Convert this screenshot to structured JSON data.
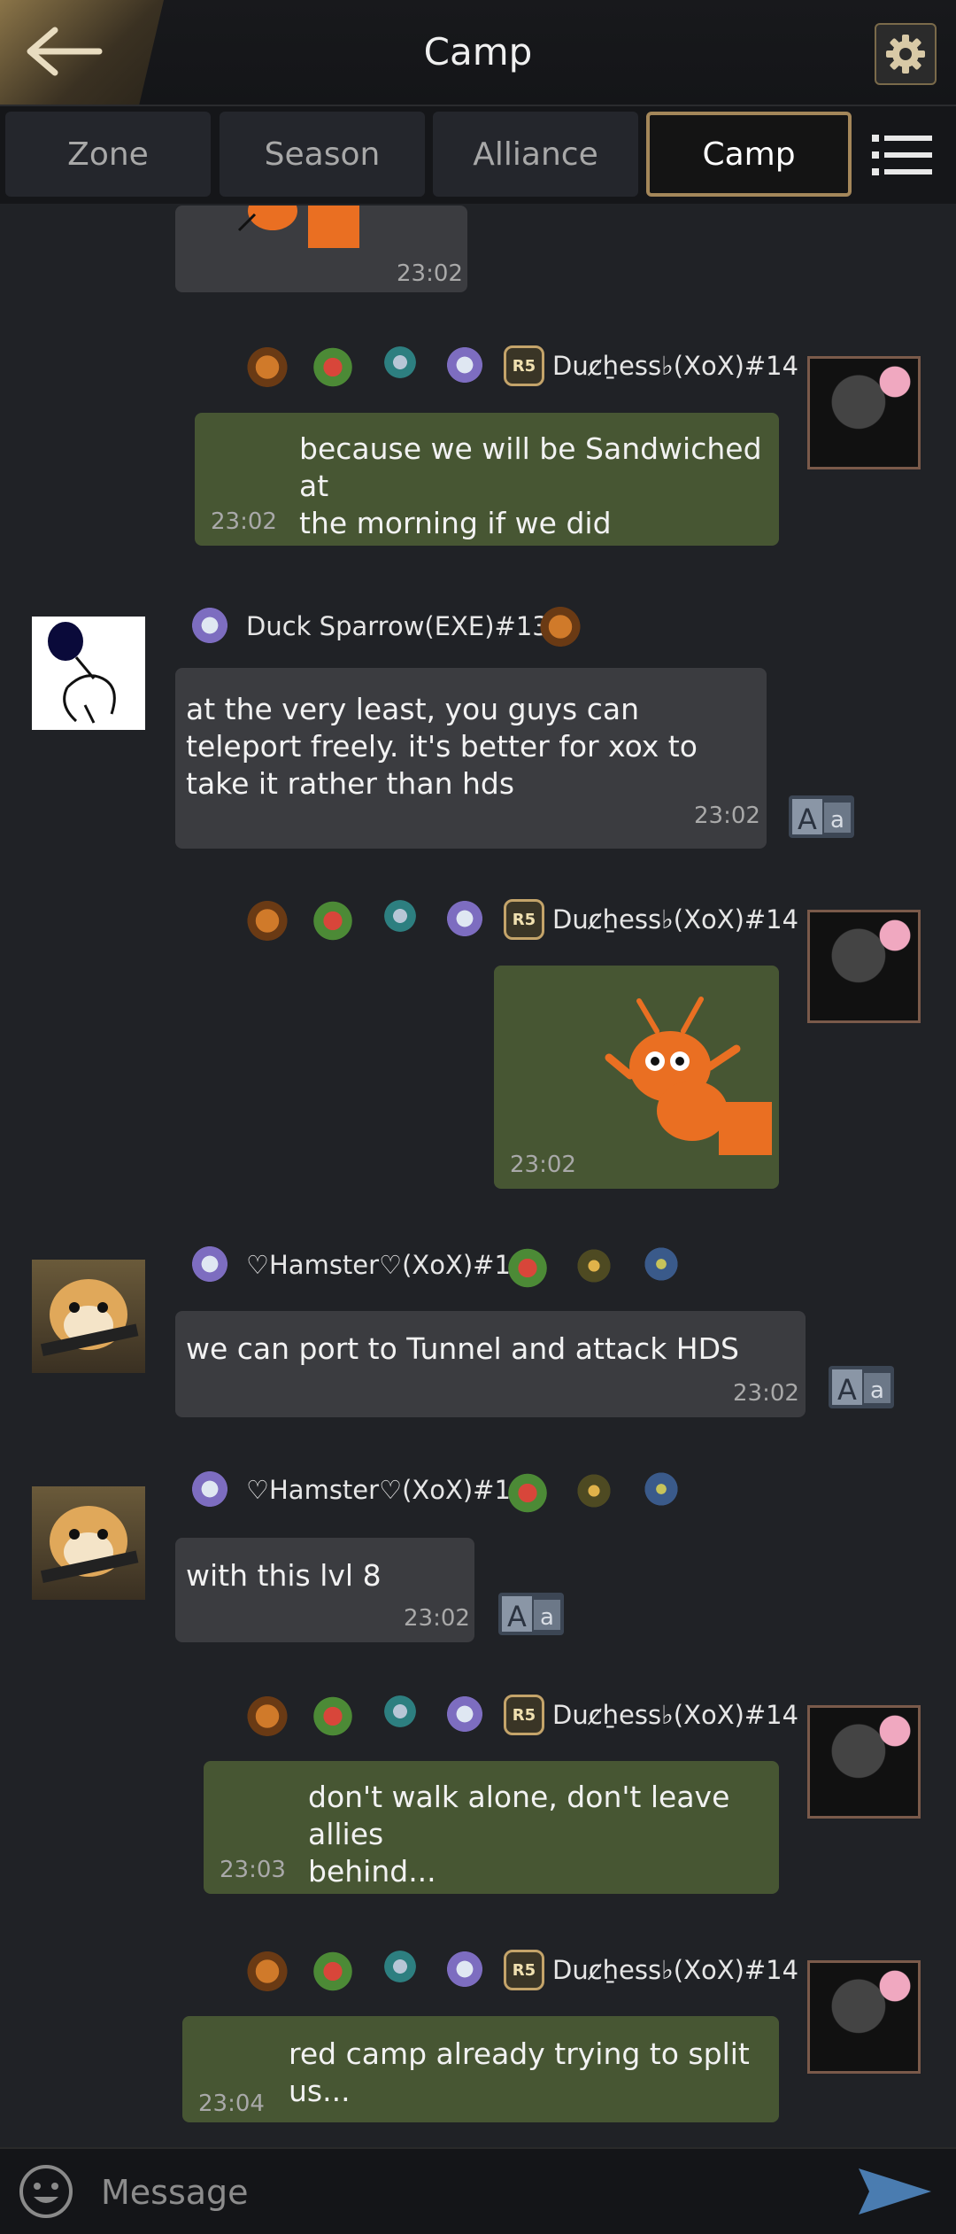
{
  "header": {
    "title": "Camp"
  },
  "tabs": [
    {
      "label": "Zone",
      "active": false
    },
    {
      "label": "Season",
      "active": false
    },
    {
      "label": "Alliance",
      "active": false
    },
    {
      "label": "Camp",
      "active": true
    }
  ],
  "rank_label": "R5",
  "messages": [
    {
      "sender": "",
      "text": "",
      "time": "23:02",
      "type": "sticker",
      "direction": "incoming"
    },
    {
      "sender": "Duc̷ẖess♭(XoX)#14",
      "text": "because we will be Sandwiched at\nthe morning if we did",
      "time": "23:02",
      "direction": "outgoing"
    },
    {
      "sender": "Duck Sparrow(EXE)#133",
      "text": "at the very least, you guys can\nteleport freely. it's better for xox to\ntake it rather than hds",
      "time": "23:02",
      "direction": "incoming"
    },
    {
      "sender": "Duc̷ẖess♭(XoX)#14",
      "text": "",
      "time": "23:02",
      "type": "sticker",
      "direction": "outgoing"
    },
    {
      "sender": "♡Hamster♡(XoX)#14",
      "text": "we can port to Tunnel and attack HDS",
      "time": "23:02",
      "direction": "incoming"
    },
    {
      "sender": "♡Hamster♡(XoX)#14",
      "text": "with this lvl 8",
      "time": "23:02",
      "direction": "incoming"
    },
    {
      "sender": "Duc̷ẖess♭(XoX)#14",
      "text": "don't walk alone, don't leave allies\nbehind...",
      "time": "23:03",
      "direction": "outgoing"
    },
    {
      "sender": "Duc̷ẖess♭(XoX)#14",
      "text": "red camp already trying to split us...",
      "time": "23:04",
      "direction": "outgoing"
    }
  ],
  "composer": {
    "placeholder": "Message"
  },
  "icons": {
    "back": "back-arrow-icon",
    "settings": "gear-icon",
    "menu": "menu-list-icon",
    "translate": "translate-icon",
    "emoji": "emoji-icon",
    "send": "send-icon"
  },
  "colors": {
    "accent_gold": "#a4875a",
    "outgoing_bubble": "#475633",
    "incoming_bubble": "#3b3c40",
    "background": "#202226"
  }
}
